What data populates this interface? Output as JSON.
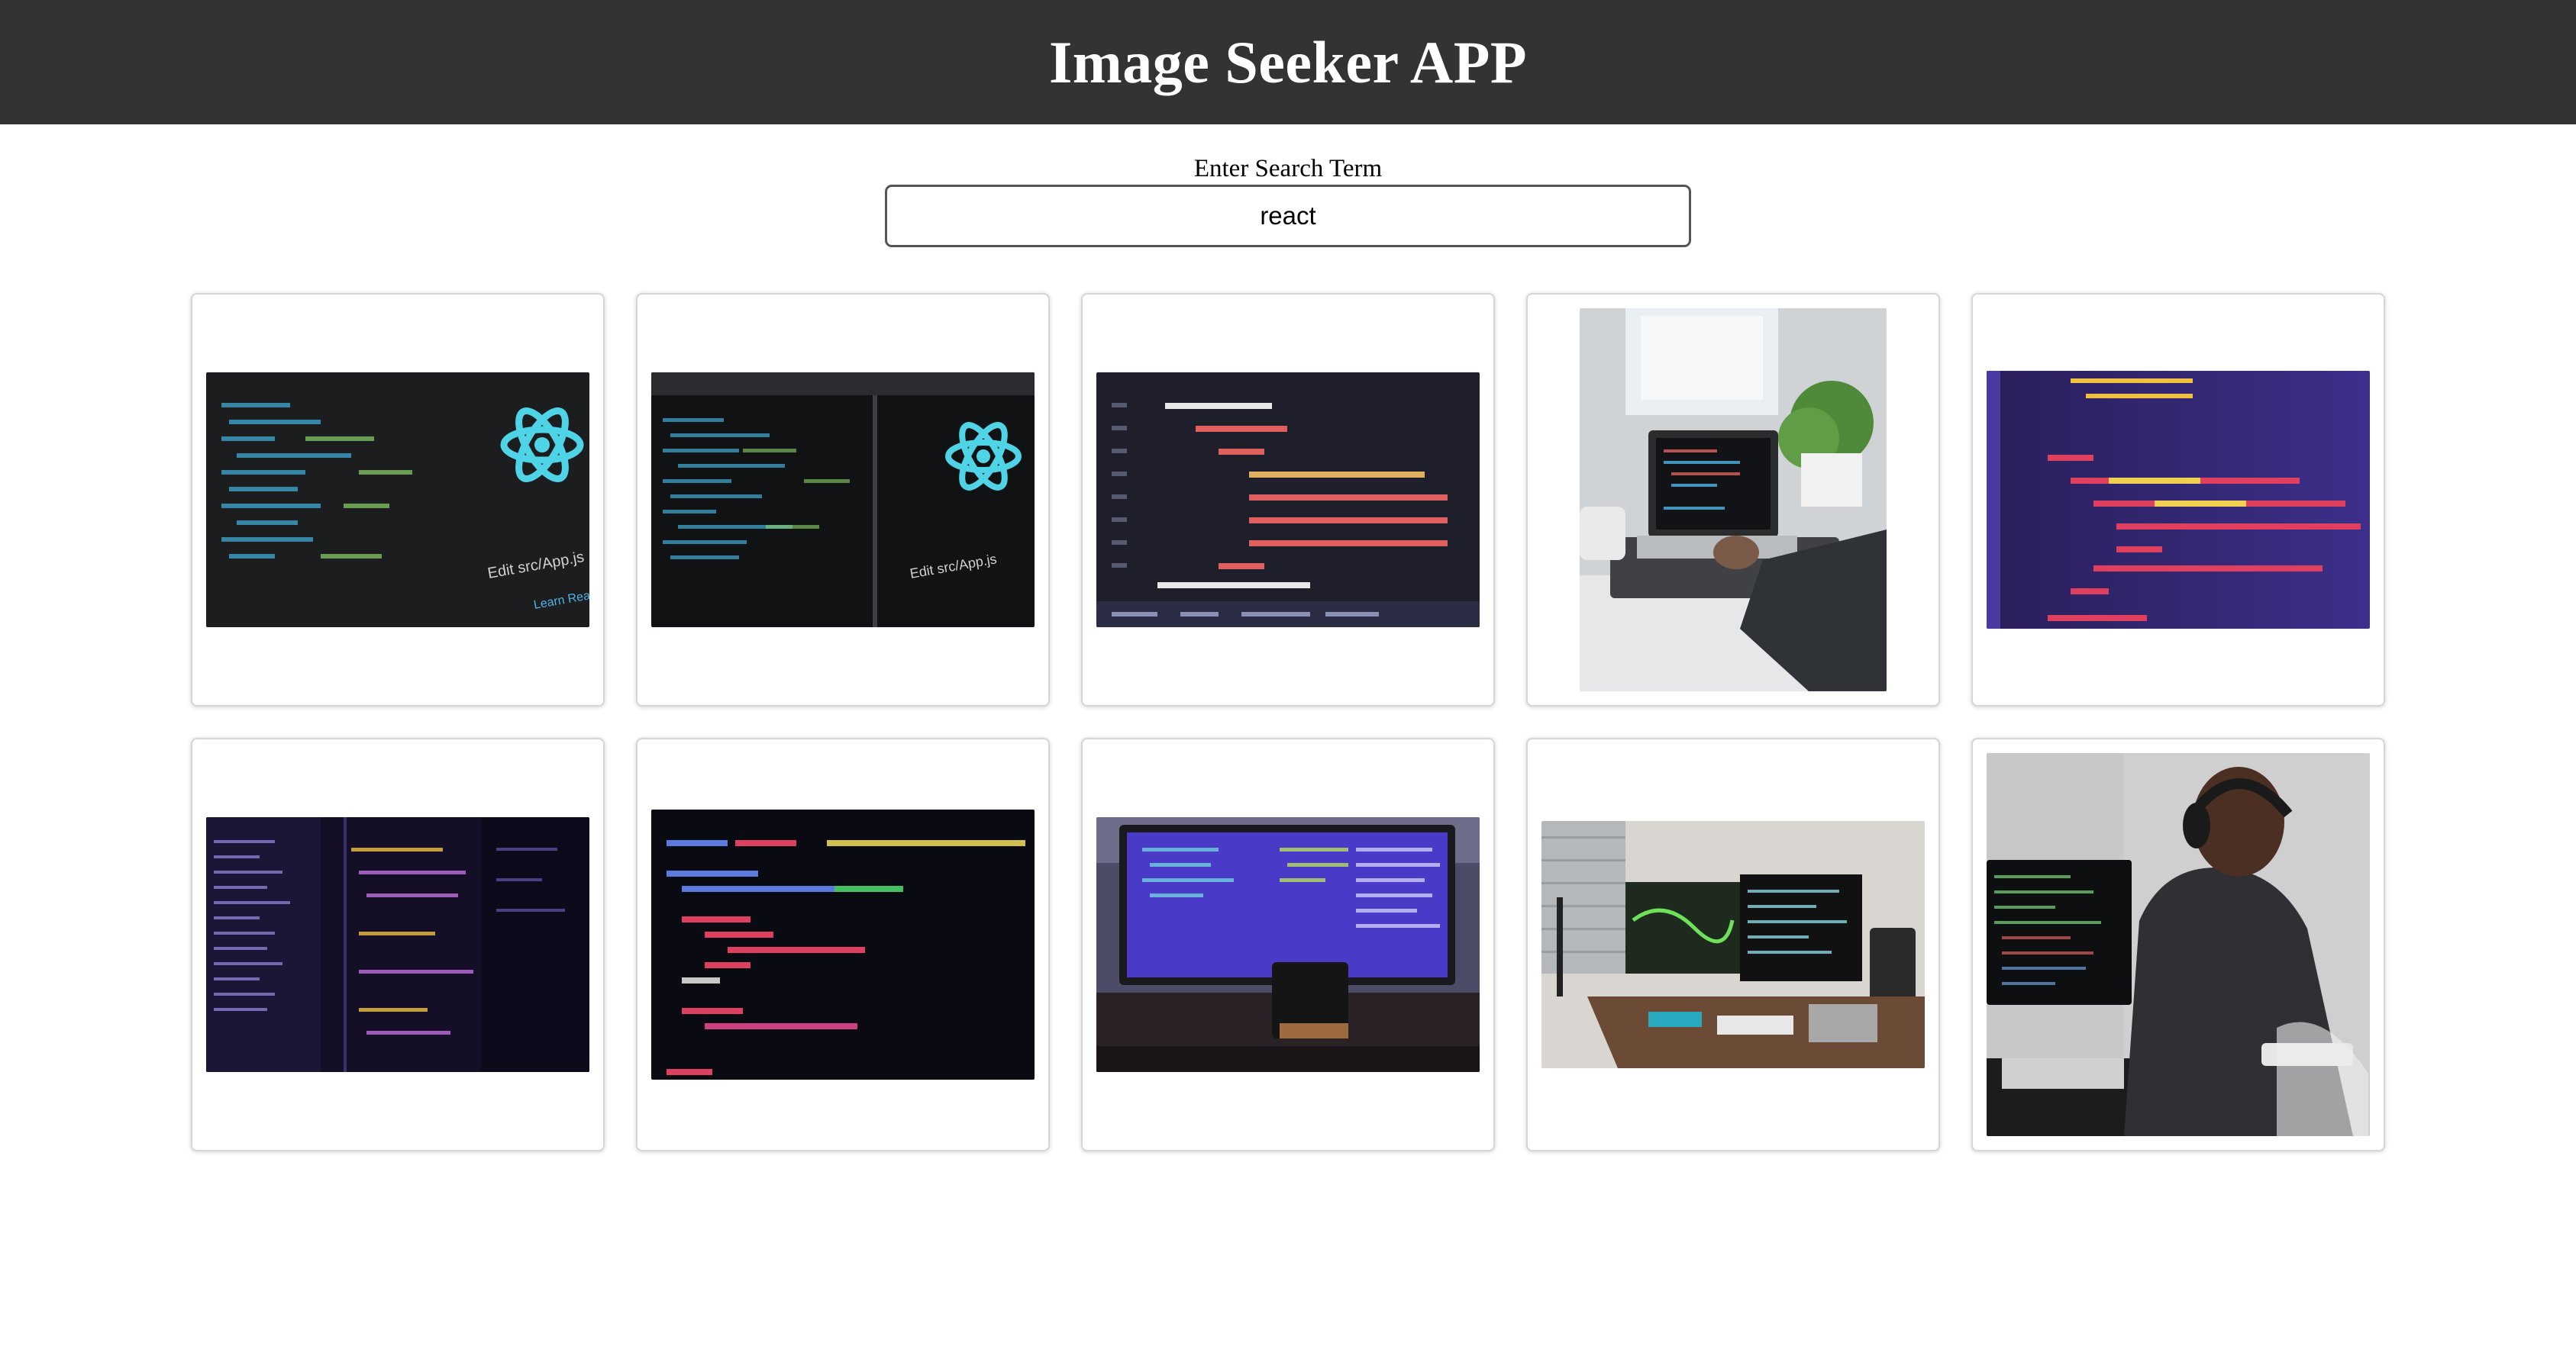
{
  "app": {
    "title": "Image Seeker APP"
  },
  "search": {
    "label": "Enter Search Term",
    "value": "react"
  },
  "results": [
    {
      "kind": "react-code-screen",
      "orientation": "landscape"
    },
    {
      "kind": "react-code-screen",
      "orientation": "landscape"
    },
    {
      "kind": "jsx-router-code",
      "orientation": "landscape"
    },
    {
      "kind": "laptop-coding-desk",
      "orientation": "portrait"
    },
    {
      "kind": "jsx-progress-code",
      "orientation": "landscape"
    },
    {
      "kind": "purple-ide-screen",
      "orientation": "landscape"
    },
    {
      "kind": "dark-code-editor",
      "orientation": "landscape"
    },
    {
      "kind": "monitor-purple-code",
      "orientation": "landscape"
    },
    {
      "kind": "desk-dual-monitors",
      "orientation": "landscape"
    },
    {
      "kind": "person-headphones-coding",
      "orientation": "portrait"
    }
  ],
  "colors": {
    "header_bg": "#333333",
    "header_text": "#ffffff",
    "card_border": "#d6d6d6"
  }
}
